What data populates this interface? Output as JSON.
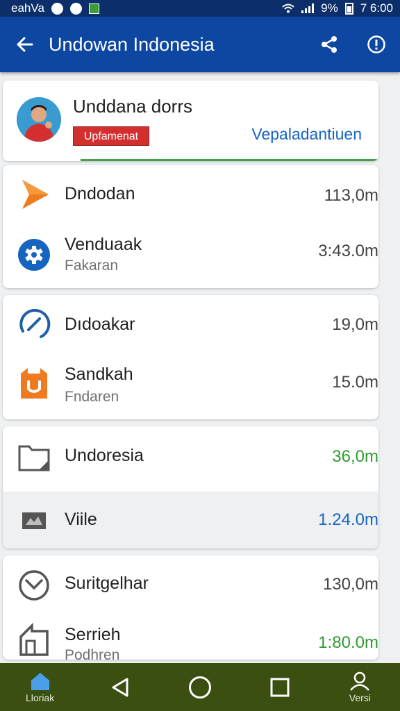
{
  "status_bar": {
    "left_text": "eahVa",
    "battery": "9%",
    "time": "7 6:00"
  },
  "app_bar": {
    "title": "Undowan Indonesia",
    "back_icon": "arrow-left-icon",
    "actions": [
      "share-icon",
      "info-icon"
    ]
  },
  "profile": {
    "name": "Unddana dorrs",
    "badge": "Upfamenat",
    "link": "Vepaladantiuen",
    "colors": {
      "badge": "#d32f2f",
      "link": "#1565c0",
      "progress": "#43a047"
    }
  },
  "groups": [
    {
      "items": [
        {
          "icon": "play-triangle-icon",
          "label": "Dndodan",
          "sub": "",
          "value": "113,0m"
        },
        {
          "icon": "gear-icon",
          "label": "Venduaak",
          "sub": "Fakaran",
          "value": "3:43.0m"
        }
      ]
    },
    {
      "items": [
        {
          "icon": "compass-icon",
          "label": "Dıdoakar",
          "sub": "",
          "value": "19,0m"
        },
        {
          "icon": "shopping-bag-icon",
          "label": "Sandkah",
          "sub": "Fndaren",
          "value": "15.0m"
        }
      ]
    },
    {
      "items": [
        {
          "icon": "folder-icon",
          "label": "Undoresia",
          "sub": "",
          "value": "36,0m",
          "value_color": "#2e9a2e"
        },
        {
          "icon": "video-icon",
          "label": "Viile",
          "sub": "",
          "value": "1.24.0m",
          "value_color": "#1565c0",
          "highlighted": true
        }
      ]
    },
    {
      "items": [
        {
          "icon": "check-circle-icon",
          "label": "Suritgelhar",
          "sub": "",
          "value": "130,0m"
        },
        {
          "icon": "house-icon",
          "label": "Serrieh",
          "sub": "Podhren",
          "value": "1:80.0m",
          "value_color": "#2e9a2e"
        }
      ]
    }
  ],
  "nav": {
    "home_label": "Lloriak",
    "profile_label": "Versi",
    "background": "#3a4f10"
  }
}
